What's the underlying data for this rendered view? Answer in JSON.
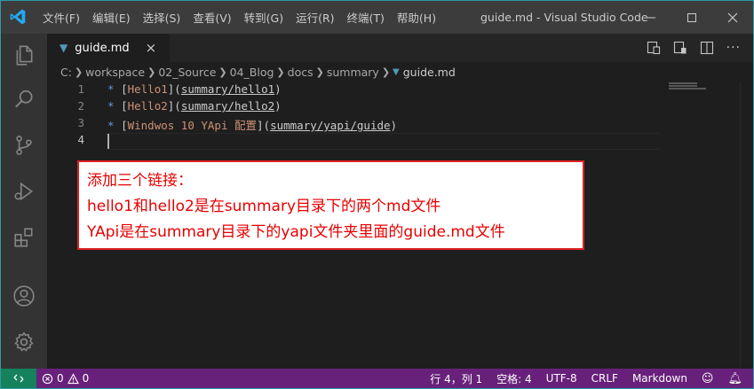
{
  "menu": [
    "文件(F)",
    "编辑(E)",
    "选择(S)",
    "查看(V)",
    "转到(G)",
    "运行(R)",
    "终端(T)",
    "帮助(H)"
  ],
  "window_title": "guide.md - Visual Studio Code",
  "tab": {
    "name": "guide.md",
    "icon": "markdown-icon"
  },
  "breadcrumb": [
    "C:",
    "workspace",
    "02_Source",
    "04_Blog",
    "docs",
    "summary",
    "guide.md"
  ],
  "editor": {
    "lines": [
      {
        "num": "1",
        "bullet": "* ",
        "open": "[",
        "text": "Hello1",
        "mid": "](",
        "url": "summary/hello1",
        "close": ")"
      },
      {
        "num": "2",
        "bullet": "* ",
        "open": "[",
        "text": "Hello2",
        "mid": "](",
        "url": "summary/hello2",
        "close": ")"
      },
      {
        "num": "3",
        "bullet": "* ",
        "open": "[",
        "text": "Windwos 10 YApi 配置",
        "mid": "](",
        "url": "summary/yapi/guide",
        "close": ")"
      },
      {
        "num": "4"
      }
    ]
  },
  "annotation": [
    "添加三个链接：",
    "hello1和hello2是在summary目录下的两个md文件",
    "YApi是在summary目录下的yapi文件夹里面的guide.md文件"
  ],
  "statusbar": {
    "errors": "0",
    "warnings": "0",
    "position": "行 4，列 1",
    "spaces": "空格: 4",
    "encoding": "UTF-8",
    "eol": "CRLF",
    "language": "Markdown"
  },
  "colors": {
    "statusbar": "#68217a",
    "remote": "#16825d",
    "accent": "#007acc",
    "annotation": "#e60000"
  }
}
